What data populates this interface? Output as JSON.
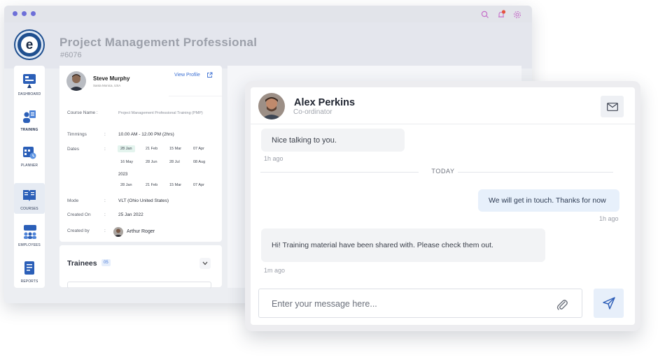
{
  "header": {
    "project_title": "Project Management Professional",
    "project_id": "#6076"
  },
  "sidebar": {
    "items": [
      {
        "label": "DASHBOARD",
        "icon": "dashboard-icon"
      },
      {
        "label": "TRAINING",
        "icon": "training-icon"
      },
      {
        "label": "PLANNER",
        "icon": "planner-icon"
      },
      {
        "label": "COURSES",
        "icon": "courses-icon",
        "active": true
      },
      {
        "label": "EMPLOYEES",
        "icon": "employees-icon"
      },
      {
        "label": "REPORTS",
        "icon": "reports-icon"
      }
    ]
  },
  "profile": {
    "name": "Steve Murphy",
    "location": "Santa Monica, USA",
    "view_profile": "View Profile"
  },
  "details": {
    "course_name_label": "Course Name :",
    "course_name": "Project Management Professional Training (PMP)",
    "timings_label": "Timmings",
    "timings": "10.00 AM - 12.00 PM (2hrs)",
    "dates_label": "Dates",
    "dates_row1": [
      "28 Jan",
      "21 Feb",
      "15 Mar",
      "07 Apr"
    ],
    "dates_row2": [
      "16 May",
      "28 Jun",
      "28 Jul",
      "08 Aug"
    ],
    "year": "2023",
    "dates_row3": [
      "28 Jan",
      "21 Feb",
      "15 Mar",
      "07 Apr"
    ],
    "mode_label": "Mode",
    "mode": "VLT (Ohio United States)",
    "created_on_label": "Created On",
    "created_on": "25 Jan 2022",
    "created_by_label": "Created by",
    "created_by": "Arthur Roger",
    "colon": ":"
  },
  "trainees": {
    "label": "Trainees",
    "count": "05"
  },
  "chat": {
    "contact_name": "Alex Perkins",
    "contact_role": "Co-ordinator",
    "messages": [
      {
        "text": "Nice talking to you.",
        "time": "1h ago",
        "direction": "in"
      },
      {
        "text": "We will get in touch. Thanks for now",
        "time": "1h ago",
        "direction": "out"
      },
      {
        "text": "Hi! Training material have been shared with. Please check them out.",
        "time": "1m ago",
        "direction": "in"
      }
    ],
    "divider": "TODAY",
    "input_placeholder": "Enter your message here..."
  },
  "colors": {
    "accent_blue": "#3b6fd3",
    "brand_navy": "#1f4f8f",
    "notification_red": "#e5533f",
    "window_dots": "#6d6fd8"
  }
}
